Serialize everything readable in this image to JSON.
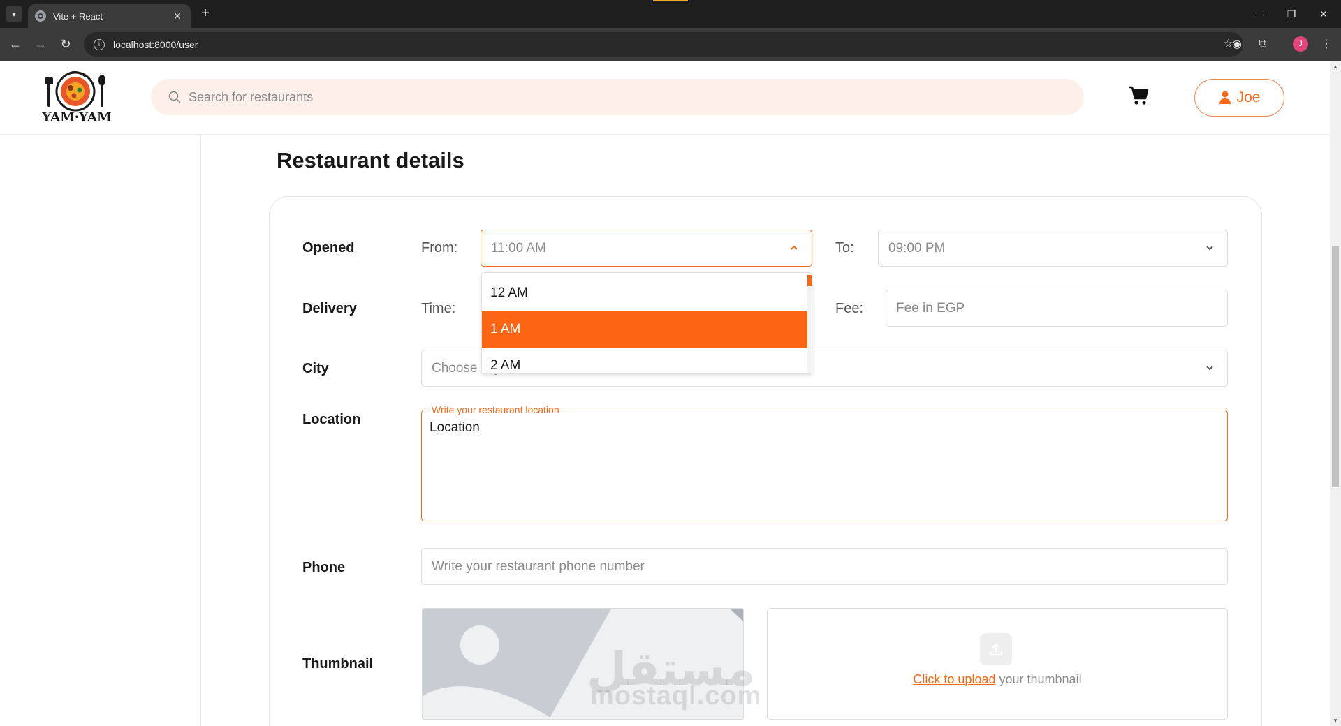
{
  "browser": {
    "tab_title": "Vite + React",
    "url": "localhost:8000/user",
    "profile_initial": "J"
  },
  "header": {
    "logo_text": "YAM·YAM",
    "search_placeholder": "Search for restaurants",
    "user_name": "Joe",
    "accent_color": "#f36a17"
  },
  "page": {
    "title": "Restaurant details"
  },
  "form": {
    "opened": {
      "label": "Opened",
      "from_label": "From:",
      "from_value": "11:00 AM",
      "to_label": "To:",
      "to_value": "09:00 PM"
    },
    "time_dropdown": {
      "options": [
        "12 AM",
        "1 AM",
        "2 AM"
      ],
      "highlighted": "1 AM"
    },
    "delivery": {
      "label": "Delivery",
      "time_label": "Time:",
      "fee_label": "Fee:",
      "fee_placeholder": "Fee in EGP"
    },
    "city": {
      "label": "City",
      "placeholder": "Choose city"
    },
    "location": {
      "label": "Location",
      "legend": "Write your restaurant location",
      "value": "Location"
    },
    "phone": {
      "label": "Phone",
      "placeholder": "Write your restaurant phone number"
    },
    "thumbnail": {
      "label": "Thumbnail",
      "upload_link": "Click to upload",
      "upload_suffix": " your thumbnail"
    }
  },
  "watermark": {
    "arabic": "مستقل",
    "latin": "mostaql.com"
  }
}
